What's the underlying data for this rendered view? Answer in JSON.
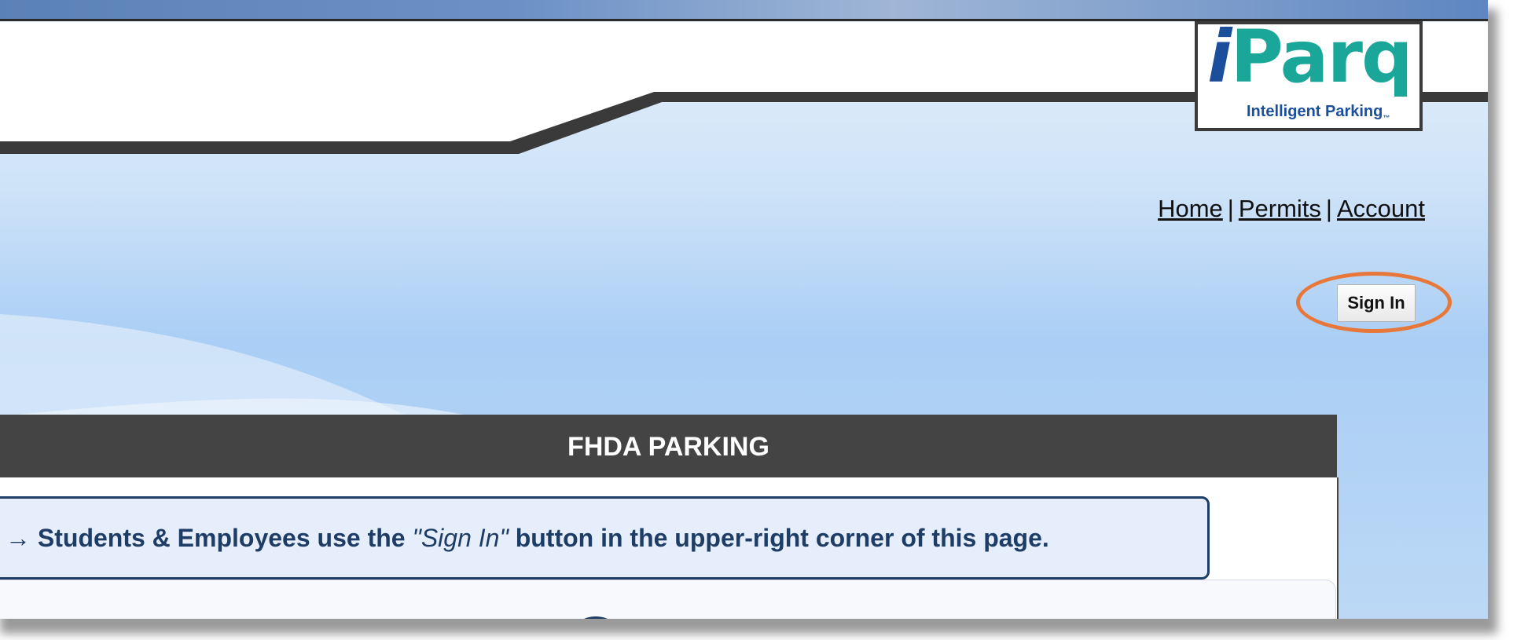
{
  "logo": {
    "brand_i": "i",
    "brand_rest": "Parq",
    "tagline": "Intelligent Parking",
    "trademark": "™"
  },
  "nav": {
    "links": [
      "Home",
      "Permits",
      "Account"
    ],
    "separator": "|"
  },
  "auth": {
    "signin_label": "Sign In"
  },
  "panel": {
    "title": "FHDA PARKING"
  },
  "notice": {
    "arrow": "→",
    "text_before": "Students & Employees use the ",
    "text_emphasis": "\"Sign In\"",
    "text_after": " button in the upper-right corner of this page."
  },
  "colors": {
    "brand_blue": "#1b4f9c",
    "brand_teal": "#1aa79a",
    "header_dark": "#444444",
    "notice_text": "#1d3c66",
    "highlight": "#e8783a"
  }
}
